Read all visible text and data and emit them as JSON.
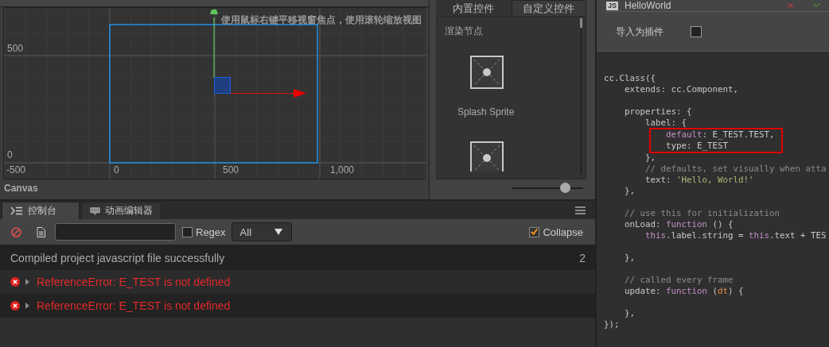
{
  "scene": {
    "hint": "使用鼠标右键平移视窗焦点，使用滚轮缩放视图",
    "y_labels": [
      "500",
      "0"
    ],
    "x_labels": [
      "-500",
      "0",
      "500",
      "1,000"
    ],
    "footer": "Canvas"
  },
  "components": {
    "tabs": [
      {
        "label": "内置控件",
        "selected": true
      },
      {
        "label": "自定义控件",
        "selected": false
      }
    ],
    "section": "渲染节点",
    "items": [
      {
        "label": "Splash Sprite"
      }
    ],
    "zoom_slider": {
      "level": 0.74
    }
  },
  "editor": {
    "badge": "JS",
    "title": "HelloWorld",
    "plugin_label": "导入为插件",
    "plugin_checked": false,
    "lines": [
      {
        "space_before": false,
        "boxed": false,
        "tokens": [
          {
            "t": "cc.Class({",
            "kind": "plain"
          }
        ]
      },
      {
        "space_before": false,
        "boxed": false,
        "tokens": [
          {
            "t": "    extends: cc.Component,",
            "kind": "plain"
          }
        ]
      },
      {
        "space_before": true,
        "boxed": false,
        "tokens": [
          {
            "t": "    properties: {",
            "kind": "plain"
          }
        ]
      },
      {
        "space_before": false,
        "boxed": false,
        "tokens": [
          {
            "t": "        label: {",
            "kind": "plain"
          }
        ]
      },
      {
        "space_before": false,
        "boxed": true,
        "tokens": [
          {
            "t": "            default",
            "kind": "keyword"
          },
          {
            "t": ": E_TEST.TEST,",
            "kind": "plain"
          }
        ]
      },
      {
        "space_before": false,
        "boxed": true,
        "tokens": [
          {
            "t": "            type: E_TEST",
            "kind": "plain"
          }
        ]
      },
      {
        "space_before": false,
        "boxed": false,
        "tokens": [
          {
            "t": "        },",
            "kind": "plain"
          }
        ]
      },
      {
        "space_before": false,
        "boxed": false,
        "tokens": [
          {
            "t": "        // defaults, set visually when atta",
            "kind": "comment"
          }
        ]
      },
      {
        "space_before": false,
        "boxed": false,
        "tokens": [
          {
            "t": "        text: ",
            "kind": "plain"
          },
          {
            "t": "'Hello, World!'",
            "kind": "string"
          }
        ]
      },
      {
        "space_before": false,
        "boxed": false,
        "tokens": [
          {
            "t": "    },",
            "kind": "plain"
          }
        ]
      },
      {
        "space_before": true,
        "boxed": false,
        "tokens": [
          {
            "t": "    // use this for initialization",
            "kind": "comment"
          }
        ]
      },
      {
        "space_before": false,
        "boxed": false,
        "tokens": [
          {
            "t": "    onLoad: ",
            "kind": "plain"
          },
          {
            "t": "function",
            "kind": "keyword"
          },
          {
            "t": " () {",
            "kind": "plain"
          }
        ]
      },
      {
        "space_before": false,
        "boxed": false,
        "tokens": [
          {
            "t": "        this",
            "kind": "keyword"
          },
          {
            "t": ".label.string = ",
            "kind": "plain"
          },
          {
            "t": "this",
            "kind": "keyword"
          },
          {
            "t": ".text + TES",
            "kind": "plain"
          }
        ]
      },
      {
        "space_before": true,
        "boxed": false,
        "tokens": [
          {
            "t": "    },",
            "kind": "plain"
          }
        ]
      },
      {
        "space_before": true,
        "boxed": false,
        "tokens": [
          {
            "t": "    // called every frame",
            "kind": "comment"
          }
        ]
      },
      {
        "space_before": false,
        "boxed": false,
        "tokens": [
          {
            "t": "    update: ",
            "kind": "plain"
          },
          {
            "t": "function",
            "kind": "keyword"
          },
          {
            "t": " (",
            "kind": "plain"
          },
          {
            "t": "dt",
            "kind": "param"
          },
          {
            "t": ") {",
            "kind": "plain"
          }
        ]
      },
      {
        "space_before": true,
        "boxed": false,
        "tokens": [
          {
            "t": "    },",
            "kind": "plain"
          }
        ]
      },
      {
        "space_before": false,
        "boxed": false,
        "tokens": [
          {
            "t": "});",
            "kind": "plain"
          }
        ]
      }
    ]
  },
  "console": {
    "tabs": [
      {
        "label": "控制台",
        "kind": "console",
        "selected": true
      },
      {
        "label": "动画编辑器",
        "kind": "animation",
        "selected": false
      }
    ],
    "regex_label": "Regex",
    "regex_checked": false,
    "level_dropdown": "All",
    "collapse_label": "Collapse",
    "collapse_checked": true,
    "rows": [
      {
        "kind": "info",
        "text": "Compiled project javascript file successfully",
        "count": "2"
      },
      {
        "kind": "error",
        "text": "ReferenceError: E_TEST is not defined"
      },
      {
        "kind": "error",
        "text": "ReferenceError: E_TEST is not defined"
      }
    ]
  }
}
